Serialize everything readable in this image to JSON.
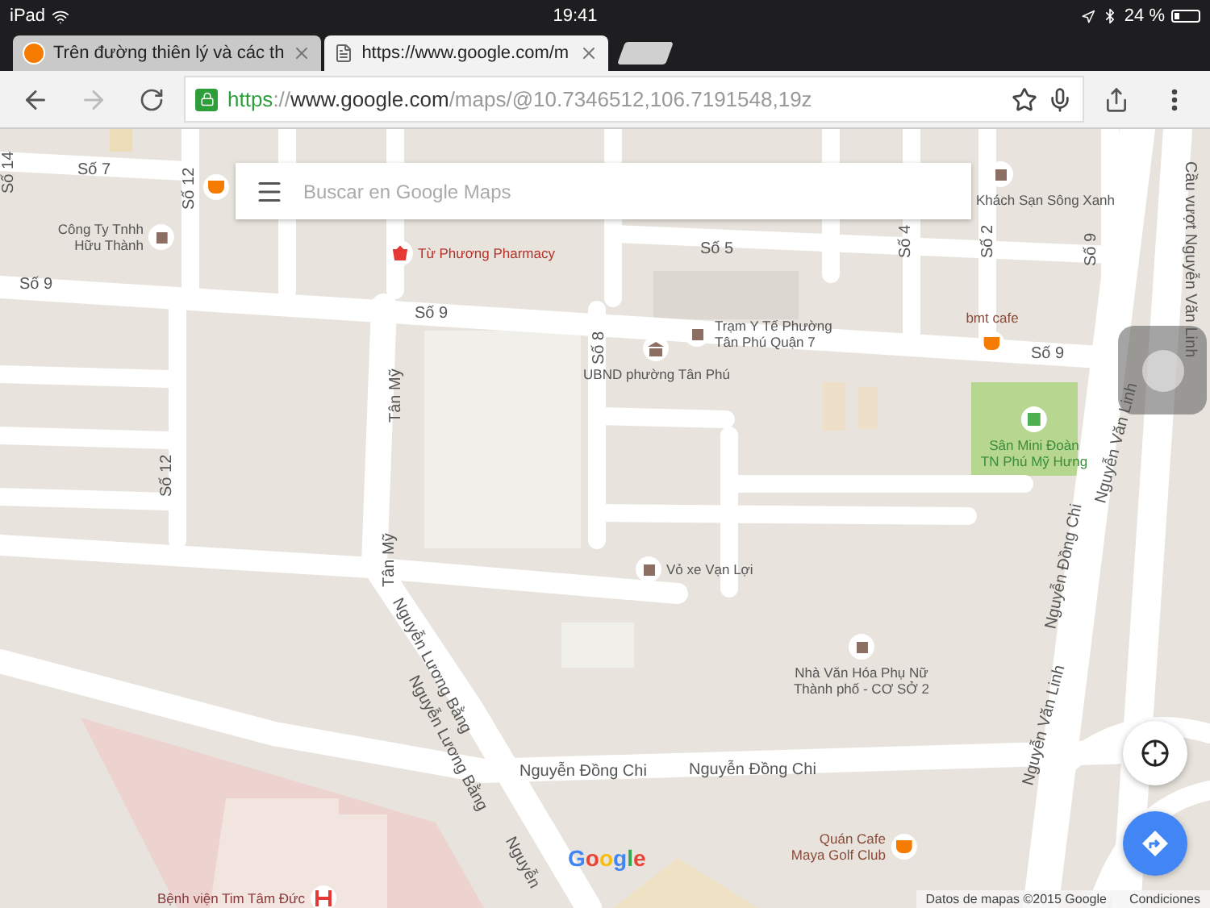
{
  "status_bar": {
    "device": "iPad",
    "time": "19:41",
    "battery": "24 %"
  },
  "tabs": [
    {
      "title": "Trên đường thiên lý và các th",
      "selected": false,
      "kind": "site"
    },
    {
      "title": "https://www.google.com/m",
      "selected": true,
      "kind": "page"
    }
  ],
  "toolbar": {
    "forward_disabled": true,
    "url": {
      "scheme": "https",
      "separator": "://",
      "host": "www.google.com",
      "path": "/maps/@10.7346512,106.7191548,19z"
    }
  },
  "search": {
    "placeholder": "Buscar en Google Maps"
  },
  "streets": [
    {
      "name": "Số 14"
    },
    {
      "name": "Số 7"
    },
    {
      "name": "Số 12"
    },
    {
      "name": "Số 9"
    },
    {
      "name": "Số 9"
    },
    {
      "name": "Số 8"
    },
    {
      "name": "Số 5"
    },
    {
      "name": "Số 4"
    },
    {
      "name": "Số 2"
    },
    {
      "name": "Số 9"
    },
    {
      "name": "Số 9"
    },
    {
      "name": "Tân Mỹ"
    },
    {
      "name": "Tân Mỹ"
    },
    {
      "name": "Số 12"
    },
    {
      "name": "Nguyễn Lương Bằng"
    },
    {
      "name": "Nguyễn Lương Bằng"
    },
    {
      "name": "Nguyễn"
    },
    {
      "name": "Nguyễn Đồng Chi"
    },
    {
      "name": "Nguyễn Đồng Chi"
    },
    {
      "name": "Nguyễn Đồng Chi"
    },
    {
      "name": "Nguyễn Văn Linh"
    },
    {
      "name": "Nguyễn Văn Linh"
    },
    {
      "name": "Cầu vượt Nguyễn Văn Linh"
    }
  ],
  "places": [
    {
      "kind": "cafe",
      "color": "#f57c00"
    },
    {
      "name": "Công Ty Tnhh\nHữu Thành",
      "kind": "building",
      "color": "#8d6e63"
    },
    {
      "name": "Từ Phương Pharmacy",
      "kind": "pharmacy",
      "color": "#e53935"
    },
    {
      "name": "Khách Sạn Sông Xanh",
      "kind": "building",
      "color": "#8d6e63"
    },
    {
      "name": "Trạm Y Tế Phường\nTân Phú Quận 7",
      "kind": "building",
      "color": "#8d6e63"
    },
    {
      "name": "UBND phường Tân Phú",
      "kind": "civic",
      "color": "#8d6e63"
    },
    {
      "name": "bmt cafe",
      "kind": "cafe",
      "color": "#f57c00"
    },
    {
      "name": "Sân Mini Đoàn\nTN Phú Mỹ Hưng",
      "kind": "park",
      "color": "#4caf50"
    },
    {
      "name": "Vỏ xe Vạn Lợi",
      "kind": "building",
      "color": "#8d6e63"
    },
    {
      "name": "Nhà Văn Hóa Phụ Nữ\nThành phố - CƠ SỞ 2",
      "kind": "building",
      "color": "#8d6e63"
    },
    {
      "name": "Quán Cafe\nMaya Golf Club",
      "kind": "cafe",
      "color": "#f57c00"
    },
    {
      "name": "Bệnh viện Tim Tâm Đức",
      "kind": "hospital",
      "color": "#e53935"
    }
  ],
  "logo": "Google",
  "attribution": "Datos de mapas ©2015 Google",
  "terms": "Condiciones"
}
